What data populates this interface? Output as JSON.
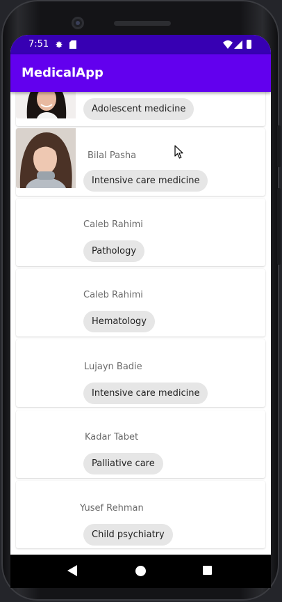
{
  "status_bar": {
    "time": "7:51",
    "icons": [
      "gear-icon",
      "sd-card-icon",
      "wifi-icon",
      "signal-icon",
      "battery-icon"
    ]
  },
  "app_bar": {
    "title": "MedicalApp"
  },
  "doctors": [
    {
      "name": "",
      "specialty": "Adolescent medicine",
      "has_photo": true
    },
    {
      "name": "Bilal Pasha",
      "specialty": "Intensive care medicine",
      "has_photo": true
    },
    {
      "name": "Caleb Rahimi",
      "specialty": "Pathology",
      "has_photo": false
    },
    {
      "name": "Caleb Rahimi",
      "specialty": "Hematology",
      "has_photo": false
    },
    {
      "name": "Lujayn Badie",
      "specialty": "Intensive care medicine",
      "has_photo": false
    },
    {
      "name": "Kadar Tabet",
      "specialty": "Palliative care",
      "has_photo": false
    },
    {
      "name": "Yusef Rehman",
      "specialty": "Child psychiatry",
      "has_photo": false
    }
  ],
  "nav_bar": {
    "icons": [
      "back-icon",
      "home-icon",
      "recents-icon"
    ]
  },
  "colors": {
    "status_bar": "#3700b3",
    "app_bar": "#6200ee",
    "chip_background": "#e6e6e6",
    "name_text": "#6a6a6a"
  }
}
